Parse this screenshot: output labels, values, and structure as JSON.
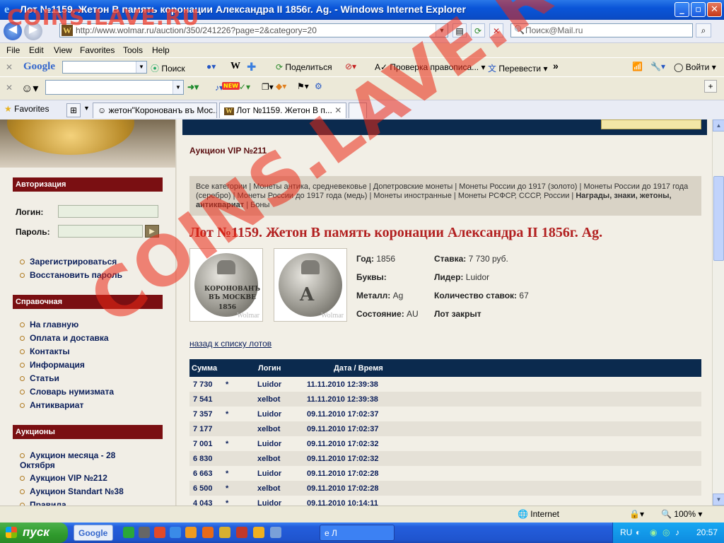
{
  "window": {
    "title": "Лот №1159. Жетон В память коронации Александра II 1856г. Ag. - Windows Internet Explorer",
    "controls": {
      "minimize": "_",
      "maximize": "▫",
      "close": "✕"
    }
  },
  "watermark": {
    "top": "COINS.LAVE.RU",
    "diagonal": "COINS.LAVE.RU"
  },
  "address_bar": {
    "url": "http://www.wolmar.ru/auction/350/241226?page=2&category=20",
    "favicon": "W",
    "search_placeholder": "Поиск@Mail.ru"
  },
  "menu": [
    "File",
    "Edit",
    "View",
    "Favorites",
    "Tools",
    "Help"
  ],
  "google_toolbar": {
    "logo": "Google",
    "search_button": "Поиск",
    "w_button": "W",
    "share": "Поделиться",
    "spellcheck": "Проверка правописа...",
    "translate": "Перевести",
    "more": "»",
    "signin": "Войти"
  },
  "second_toolbar": {
    "new_badge": "NEW"
  },
  "tabs_bar": {
    "favorites_label": "Favorites",
    "tabs": [
      {
        "label": "жетон\"Коронованъ въ Мос..."
      },
      {
        "label": "Лот №1159. Жетон В п..."
      }
    ]
  },
  "sidebar": {
    "auth_header": "Авторизация",
    "login_label": "Логин:",
    "password_label": "Пароль:",
    "go": "▶",
    "auth_links": [
      "Зарегистрироваться",
      "Восстановить пароль"
    ],
    "ref_header": "Справочная",
    "ref_links": [
      "На главную",
      "Оплата и доставка",
      "Контакты",
      "Информация",
      "Статьи",
      "Словарь нумизмата",
      "Антиквариат"
    ],
    "auctions_header": "Аукционы",
    "auction_links": [
      "Аукцион месяца - 28 Октября",
      "Аукцион VIP №212",
      "Аукцион Standart №38",
      "Правила"
    ]
  },
  "main": {
    "auction_title": "Аукцион VIP №211",
    "categories_text": "Все категории | Монеты антика, средневековье | Допетровские монеты | Монеты России до 1917 (золото) | Монеты России до 1917 года (серебро) | Монеты России до 1917 года (медь) | Монеты иностранные | Монеты РСФСР, СССР, России |",
    "categories_bold": "Награды, знаки, жетоны, антиквариат",
    "categories_tail": "| Боны",
    "lot_title": "Лот №1159.  Жетон В память коронации Александра II 1856г. Ag.",
    "coin_obverse_text": [
      "КОРОНОВАНЪ",
      "ВЪ МОСКВЕ",
      "1856"
    ],
    "coin_watermark": "Wolmar",
    "info": {
      "year_label": "Год:",
      "year": "1856",
      "letters_label": "Буквы:",
      "letters": "",
      "metal_label": "Металл:",
      "metal": "Ag",
      "condition_label": "Состояние:",
      "condition": "AU",
      "bid_label": "Ставка:",
      "bid": "7 730 руб.",
      "leader_label": "Лидер:",
      "leader": "Luidor",
      "bids_count_label": "Количество ставок:",
      "bids_count": "67",
      "status": "Лот закрыт"
    },
    "back_link": "назад к списку лотов",
    "bids_table": {
      "headers": [
        "Сумма",
        "",
        "Логин",
        "Дата / Время"
      ],
      "rows": [
        {
          "sum": "7 730",
          "star": "*",
          "login": "Luidor",
          "datetime": "11.11.2010 12:39:38"
        },
        {
          "sum": "7 541",
          "star": "",
          "login": "xelbot",
          "datetime": "11.11.2010 12:39:38"
        },
        {
          "sum": "7 357",
          "star": "*",
          "login": "Luidor",
          "datetime": "09.11.2010 17:02:37"
        },
        {
          "sum": "7 177",
          "star": "",
          "login": "xelbot",
          "datetime": "09.11.2010 17:02:37"
        },
        {
          "sum": "7 001",
          "star": "*",
          "login": "Luidor",
          "datetime": "09.11.2010 17:02:32"
        },
        {
          "sum": "6 830",
          "star": "",
          "login": "xelbot",
          "datetime": "09.11.2010 17:02:32"
        },
        {
          "sum": "6 663",
          "star": "*",
          "login": "Luidor",
          "datetime": "09.11.2010 17:02:28"
        },
        {
          "sum": "6 500",
          "star": "*",
          "login": "xelbot",
          "datetime": "09.11.2010 17:02:28"
        },
        {
          "sum": "4 043",
          "star": "*",
          "login": "Luidor",
          "datetime": "09.11.2010 10:14:11"
        }
      ]
    }
  },
  "status_bar": {
    "zone": "Internet",
    "zoom": "100%"
  },
  "taskbar": {
    "start": "пуск",
    "google_button": "Google",
    "task": "Л",
    "lang": "RU",
    "clock": "20:57"
  },
  "colors": {
    "accent_red": "#B22020",
    "header_navy": "#0B2A4E",
    "sidebar_header": "#7A0F12"
  }
}
